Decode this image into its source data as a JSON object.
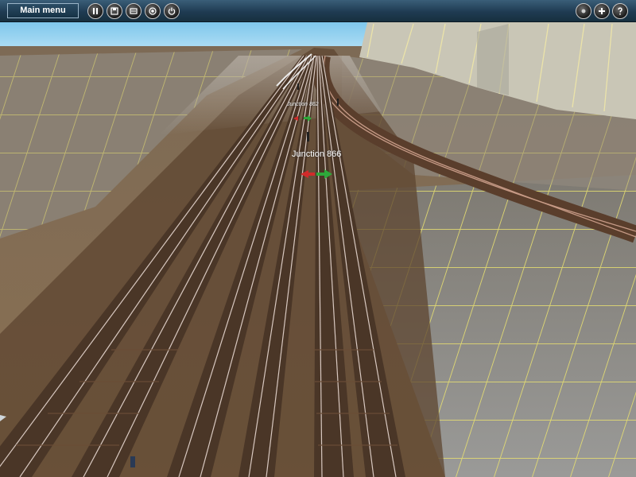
{
  "toolbar": {
    "main_menu_label": "Main menu",
    "left_buttons": [
      "pause-icon",
      "save-icon",
      "options-icon",
      "record-icon",
      "power-icon"
    ],
    "right_buttons": [
      "info-dot-icon",
      "add-icon",
      "help-icon"
    ]
  },
  "scene": {
    "junctions": [
      {
        "label": "Junction 866",
        "left_state": "red",
        "right_state": "green"
      },
      {
        "label": "Junction 862",
        "left_state": "red",
        "right_state": "green"
      }
    ],
    "colors": {
      "sky": "#8fd0f0",
      "ground": "#8a7255",
      "grid_line": "#e8e070",
      "tile": "#8d8d8d",
      "rail": "#e6e6e6"
    }
  }
}
